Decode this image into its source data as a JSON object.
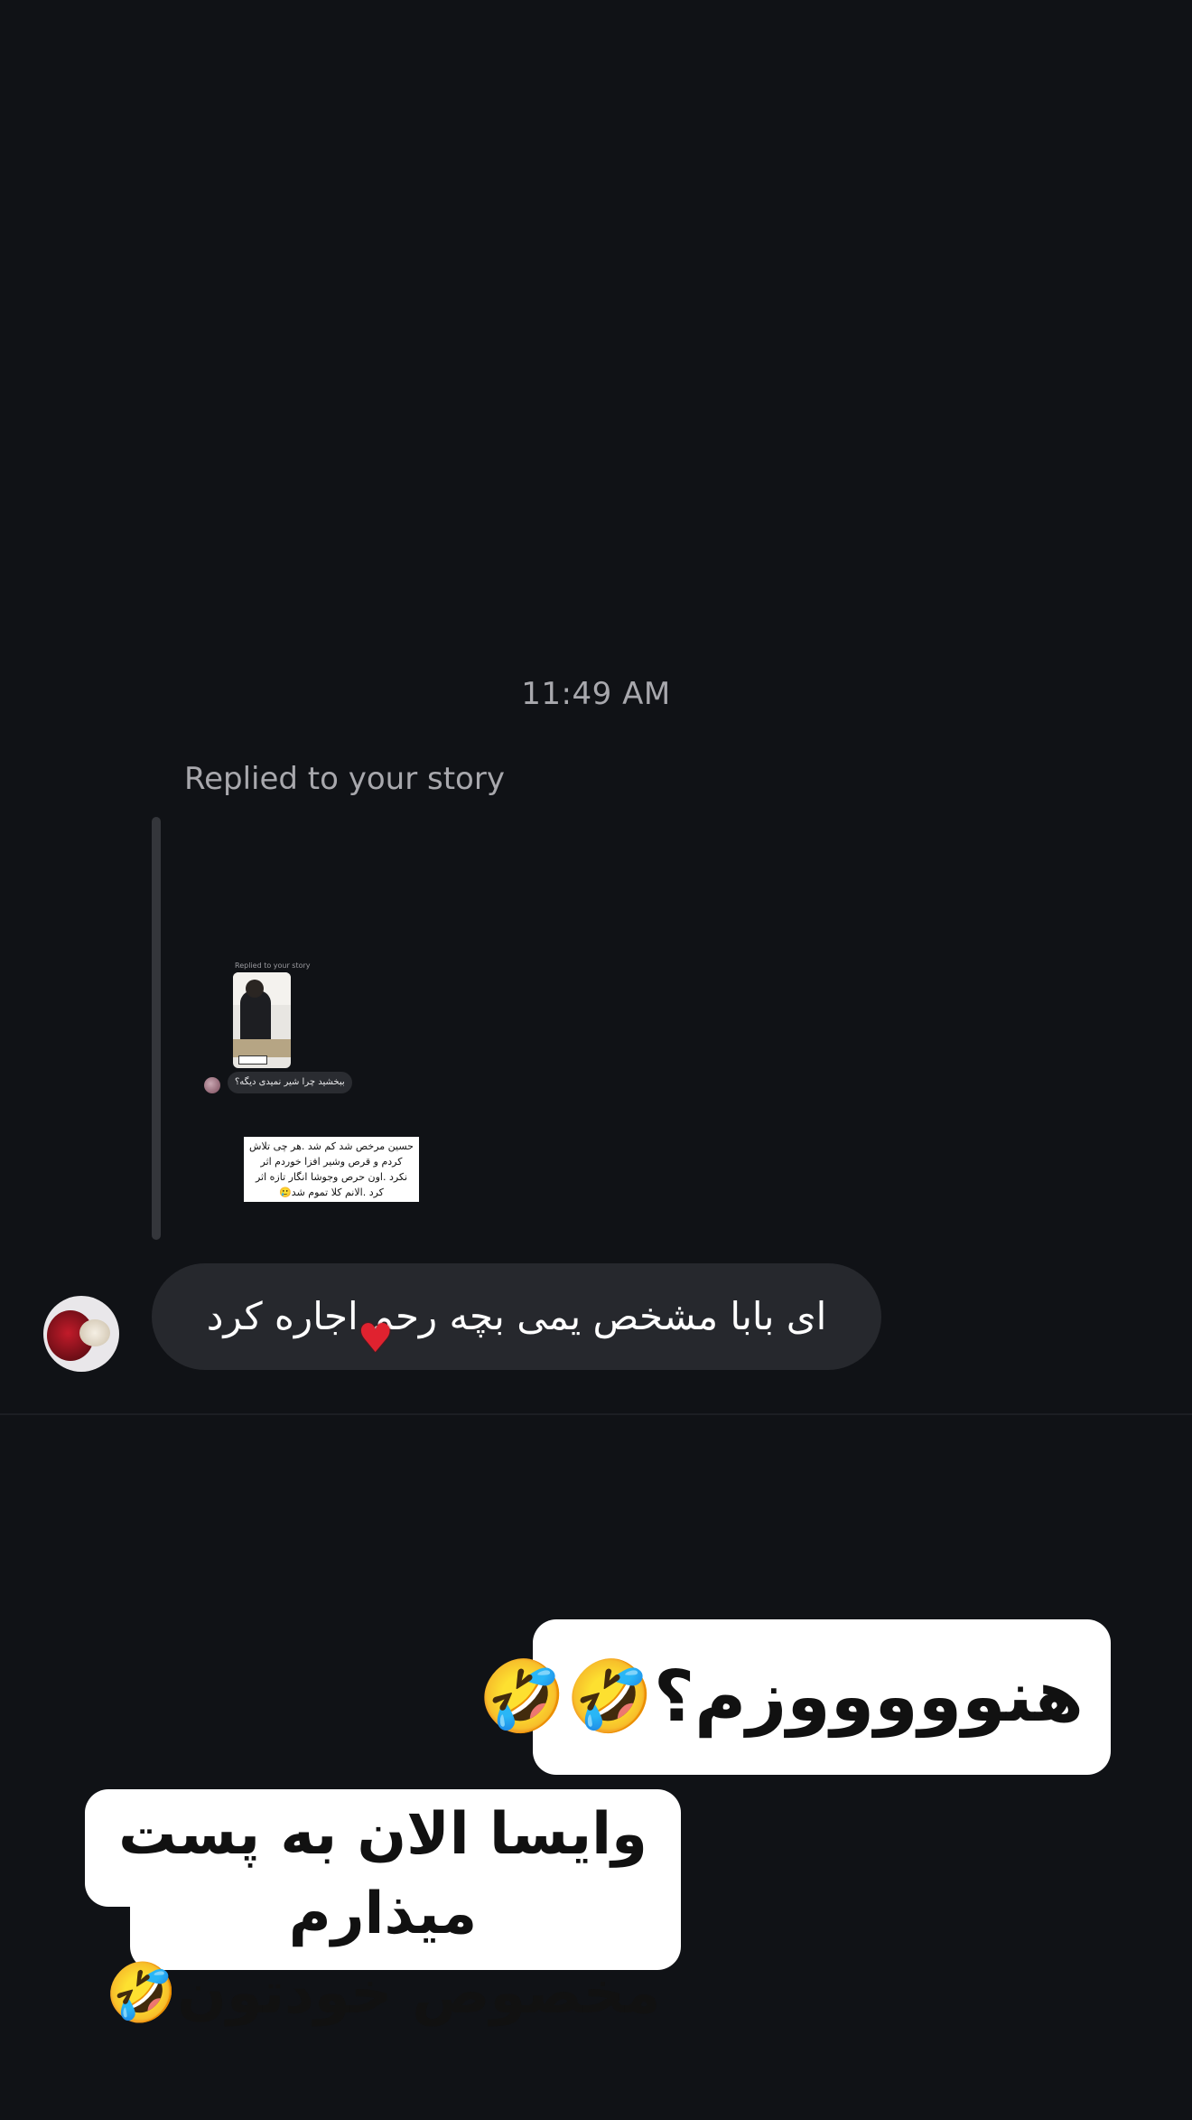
{
  "thread": {
    "timestamp": "11:49 AM",
    "replied_label": "Replied to your story"
  },
  "story_preview": {
    "nested_replied_label": "Replied to your story",
    "nested_message": "ببخشید چرا شیر نمیدی دیگه؟",
    "caption_lines": [
      "حسین مرخص شد کم شد .هر چی تلاش",
      "کردم و قرص وشیر افزا خوردم اثر",
      "نکرد .اون حرص وجوشا انگار تازه اثر",
      "کرد .الانم کلا تموم شد🥲"
    ]
  },
  "message": {
    "text": "ای بابا  مشخص یمی بچه رحم اجاره کرد",
    "reaction": "❤️"
  },
  "stickers": {
    "first": "هنوووووزم؟🤣🤣",
    "second_line1": "وایسا الان به پست میذارم",
    "second_line2": "مخصوص خودتون🤣"
  },
  "colors": {
    "background": "#101216",
    "bubble": "#26282d",
    "muted_text": "#a8a8ad",
    "reply_bar": "#34363b",
    "heart": "#e0222f",
    "sticker_bg": "#ffffff"
  },
  "icons": {
    "reaction": "heart-icon",
    "avatar": "rose-bouquet-avatar"
  }
}
